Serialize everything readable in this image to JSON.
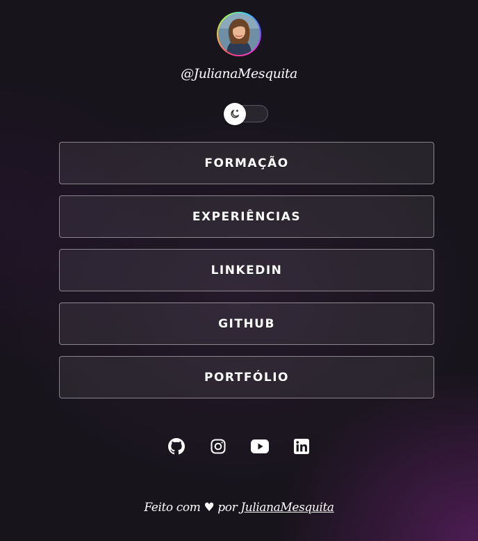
{
  "profile": {
    "handle": "@JulianaMesquita"
  },
  "theme_toggle": {
    "icon": "moon-icon",
    "state": "dark"
  },
  "links": [
    {
      "label": "FORMAÇÃO"
    },
    {
      "label": "EXPERIÊNCIAS"
    },
    {
      "label": "LINKEDIN"
    },
    {
      "label": "GITHUB"
    },
    {
      "label": "PORTFÓLIO"
    }
  ],
  "socials": [
    {
      "icon": "github-icon"
    },
    {
      "icon": "instagram-icon"
    },
    {
      "icon": "youtube-icon"
    },
    {
      "icon": "linkedin-icon"
    }
  ],
  "footer": {
    "prefix": "Feito com ♥ por",
    "author": "JulianaMesquita"
  },
  "colors": {
    "background": "#17141b",
    "accent_glow": "#561e5c",
    "text": "#ffffff",
    "button_border": "#737078"
  }
}
